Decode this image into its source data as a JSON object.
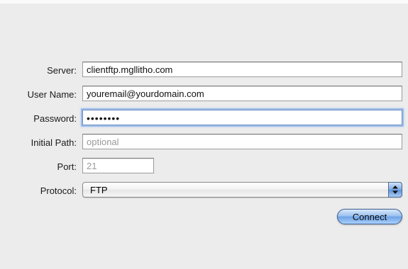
{
  "form": {
    "server": {
      "label": "Server:",
      "value": "clientftp.mgllitho.com"
    },
    "user_name": {
      "label": "User Name:",
      "value": "youremail@yourdomain.com"
    },
    "password": {
      "label": "Password:",
      "value": "••••••••"
    },
    "initial_path": {
      "label": "Initial Path:",
      "placeholder": "optional"
    },
    "port": {
      "label": "Port:",
      "value": "21"
    },
    "protocol": {
      "label": "Protocol:",
      "selected": "FTP"
    },
    "connect_label": "Connect"
  },
  "icons": {
    "protocol_popup": "up-down-arrows-icon"
  },
  "colors": {
    "window_background": "#ececec",
    "focus_ring": "#9ebde9",
    "aqua_button": "#6fa3e6"
  }
}
